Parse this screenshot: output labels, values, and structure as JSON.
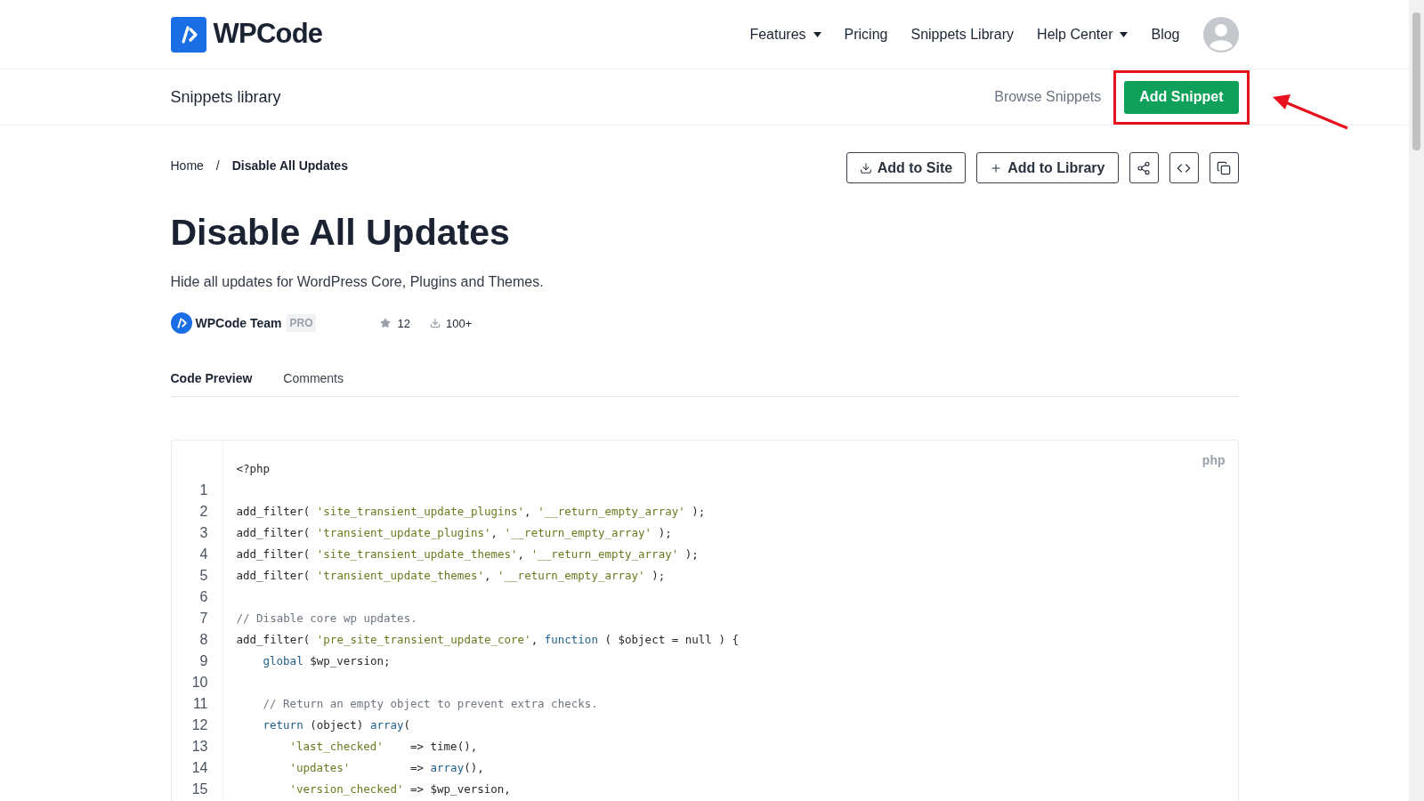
{
  "header": {
    "logo_text": "WPCode",
    "nav": [
      {
        "label": "Features",
        "has_menu": true
      },
      {
        "label": "Pricing",
        "has_menu": false
      },
      {
        "label": "Snippets Library",
        "has_menu": false
      },
      {
        "label": "Help Center",
        "has_menu": true
      },
      {
        "label": "Blog",
        "has_menu": false
      }
    ]
  },
  "subheader": {
    "title": "Snippets library",
    "link": "Browse Snippets",
    "button": "Add Snippet",
    "highlighted": true
  },
  "breadcrumb": [
    {
      "label": "Home",
      "current": false
    },
    {
      "label": "/",
      "current": false
    },
    {
      "label": "Disable All Updates",
      "current": true
    }
  ],
  "actions": [
    {
      "kind": "download",
      "label": "Add to Site"
    },
    {
      "kind": "plus",
      "label": "Add to Library"
    },
    {
      "kind": "share"
    },
    {
      "kind": "code"
    },
    {
      "kind": "copy"
    }
  ],
  "snippet": {
    "title": "Disable All Updates",
    "description": "Hide all updates for WordPress Core, Plugins and Themes.",
    "author": "WPCode Team",
    "badge": "PRO",
    "stars_count": "12",
    "downloads": "100+"
  },
  "tabs": [
    {
      "label": "Code Preview",
      "selected": true
    },
    {
      "label": "Comments",
      "selected": false
    }
  ],
  "code": {
    "language": "php",
    "lines": [
      {
        "tokens": [
          {
            "kind": "plain",
            "text": "<?php"
          }
        ]
      },
      {
        "number": "1"
      },
      {
        "number": "2",
        "tokens": [
          {
            "kind": "plain",
            "text": "add_filter( "
          },
          {
            "kind": "str",
            "text": "'site_transient_update_plugins'"
          },
          {
            "kind": "plain",
            "text": ", "
          },
          {
            "kind": "str",
            "text": "'__return_empty_array'"
          },
          {
            "kind": "plain",
            "text": " );"
          }
        ]
      },
      {
        "number": "3",
        "tokens": [
          {
            "kind": "plain",
            "text": "add_filter( "
          },
          {
            "kind": "str",
            "text": "'transient_update_plugins'"
          },
          {
            "kind": "plain",
            "text": ", "
          },
          {
            "kind": "str",
            "text": "'__return_empty_array'"
          },
          {
            "kind": "plain",
            "text": " );"
          }
        ]
      },
      {
        "number": "4",
        "tokens": [
          {
            "kind": "plain",
            "text": "add_filter( "
          },
          {
            "kind": "str",
            "text": "'site_transient_update_themes'"
          },
          {
            "kind": "plain",
            "text": ", "
          },
          {
            "kind": "str",
            "text": "'__return_empty_array'"
          },
          {
            "kind": "plain",
            "text": " );"
          }
        ]
      },
      {
        "number": "5",
        "tokens": [
          {
            "kind": "plain",
            "text": "add_filter( "
          },
          {
            "kind": "str",
            "text": "'transient_update_themes'"
          },
          {
            "kind": "plain",
            "text": ", "
          },
          {
            "kind": "str",
            "text": "'__return_empty_array'"
          },
          {
            "kind": "plain",
            "text": " );"
          }
        ]
      },
      {
        "number": "6"
      },
      {
        "number": "7",
        "tokens": [
          {
            "kind": "comment",
            "text": "// Disable core wp updates."
          }
        ]
      },
      {
        "number": "8",
        "tokens": [
          {
            "kind": "plain",
            "text": "add_filter( "
          },
          {
            "kind": "str",
            "text": "'pre_site_transient_update_core'"
          },
          {
            "kind": "plain",
            "text": ", "
          },
          {
            "kind": "kw",
            "text": "function"
          },
          {
            "kind": "plain",
            "text": " ( $object = null ) {"
          }
        ],
        "children": [
          {
            "number": "9",
            "tokens": [
              {
                "kind": "kw",
                "text": "global"
              },
              {
                "kind": "plain",
                "text": " $wp_version;"
              }
            ]
          },
          {
            "number": "10"
          },
          {
            "number": "11",
            "tokens": [
              {
                "kind": "comment",
                "text": "// Return an empty object to prevent extra checks."
              }
            ]
          },
          {
            "number": "12",
            "tokens": [
              {
                "kind": "kw",
                "text": "return"
              },
              {
                "kind": "plain",
                "text": " (object) "
              },
              {
                "kind": "kw",
                "text": "array"
              },
              {
                "kind": "plain",
                "text": "("
              }
            ],
            "children": [
              {
                "number": "13",
                "tokens": [
                  {
                    "kind": "str",
                    "text": "'last_checked'"
                  },
                  {
                    "kind": "plain",
                    "text": "    => time(),"
                  }
                ]
              },
              {
                "number": "14",
                "tokens": [
                  {
                    "kind": "str",
                    "text": "'updates'"
                  },
                  {
                    "kind": "plain",
                    "text": "         => "
                  },
                  {
                    "kind": "kw",
                    "text": "array"
                  },
                  {
                    "kind": "plain",
                    "text": "(),"
                  }
                ]
              },
              {
                "number": "15",
                "tokens": [
                  {
                    "kind": "str",
                    "text": "'version_checked'"
                  },
                  {
                    "kind": "plain",
                    "text": " => $wp_version,"
                  }
                ]
              }
            ]
          }
        ]
      }
    ]
  }
}
